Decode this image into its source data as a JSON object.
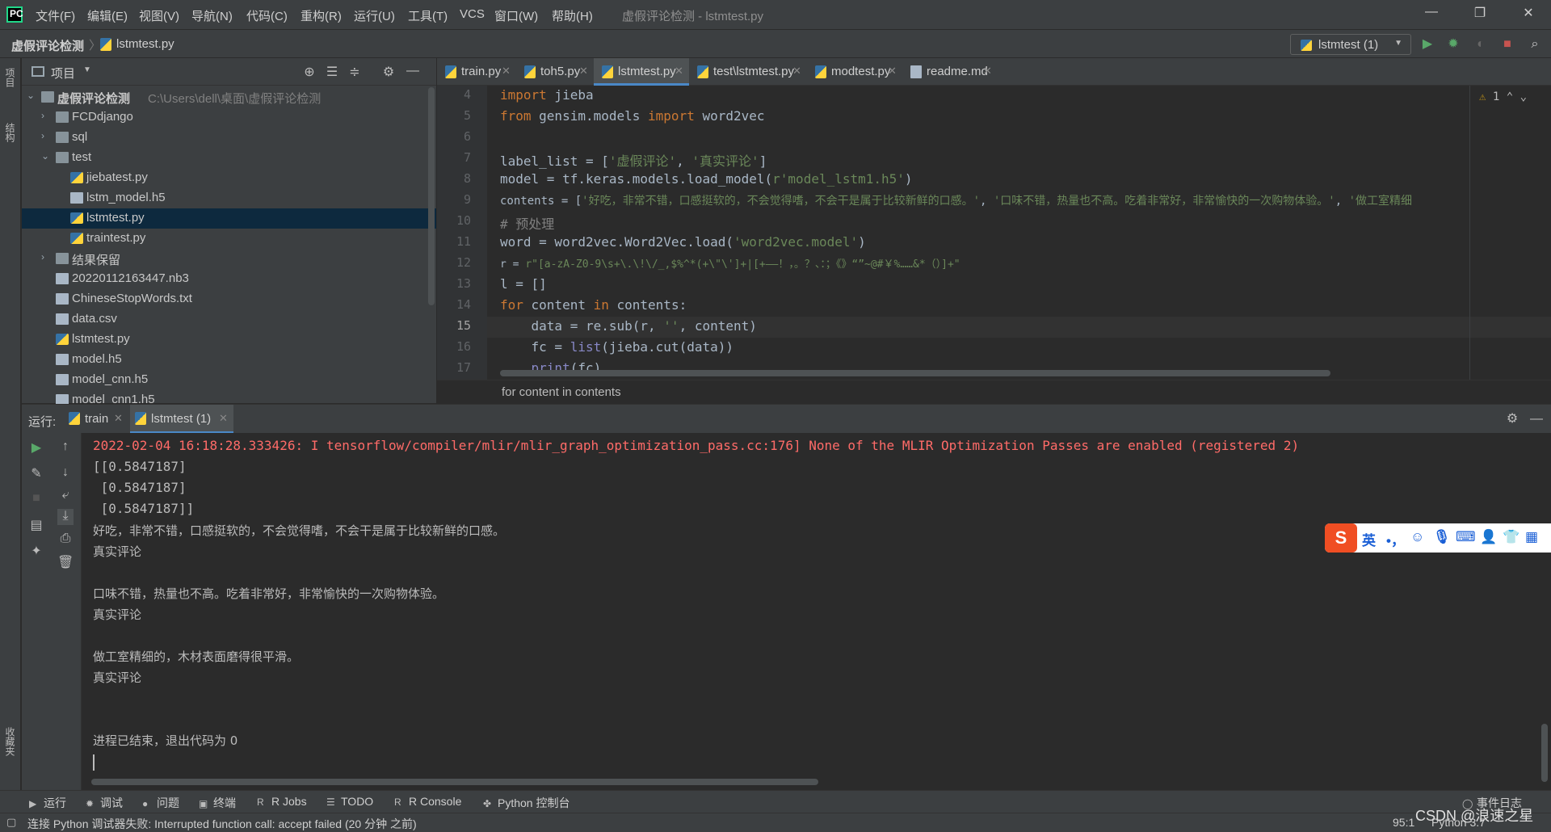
{
  "app": {
    "menu": [
      "文件(F)",
      "编辑(E)",
      "视图(V)",
      "导航(N)",
      "代码(C)",
      "重构(R)",
      "运行(U)",
      "工具(T)",
      "VCS",
      "窗口(W)",
      "帮助(H)"
    ],
    "window_title": "虚假评论检测 - lstmtest.py"
  },
  "navbar": {
    "project": "虚假评论检测",
    "file": "lstmtest.py",
    "run_config": "lstmtest (1)"
  },
  "left_strip": {
    "project_tab": "项目",
    "structure_tab": "结构",
    "favorites_tab": "收藏夹"
  },
  "project_panel": {
    "title": "项目",
    "tree": [
      {
        "label": "虚假评论检测",
        "path": "C:\\Users\\dell\\桌面\\虚假评论检测",
        "type": "folder",
        "expanded": true
      },
      {
        "label": "FCDdjango",
        "type": "folder",
        "expanded": false
      },
      {
        "label": "sql",
        "type": "folder",
        "expanded": false
      },
      {
        "label": "test",
        "type": "folder",
        "expanded": true
      },
      {
        "label": "jiebatest.py",
        "type": "py"
      },
      {
        "label": "lstm_model.h5",
        "type": "file"
      },
      {
        "label": "lstmtest.py",
        "type": "py",
        "selected": true
      },
      {
        "label": "traintest.py",
        "type": "py"
      },
      {
        "label": "结果保留",
        "type": "folder",
        "expanded": false
      },
      {
        "label": "20220112163447.nb3",
        "type": "file"
      },
      {
        "label": "ChineseStopWords.txt",
        "type": "file"
      },
      {
        "label": "data.csv",
        "type": "file"
      },
      {
        "label": "lstmtest.py",
        "type": "py"
      },
      {
        "label": "model.h5",
        "type": "file"
      },
      {
        "label": "model_cnn.h5",
        "type": "file"
      },
      {
        "label": "model_cnn1.h5",
        "type": "file"
      }
    ]
  },
  "editor": {
    "tabs": [
      "train.py",
      "toh5.py",
      "lstmtest.py",
      "test\\lstmtest.py",
      "modtest.py",
      "readme.md"
    ],
    "active_tab": "lstmtest.py",
    "warnings": "1",
    "line_numbers": [
      "4",
      "5",
      "6",
      "7",
      "8",
      "9",
      "10",
      "11",
      "12",
      "13",
      "14",
      "15",
      "16",
      "17"
    ],
    "current_line": "15",
    "code": {
      "l4_kw": "import",
      "l4_rest": " jieba",
      "l5_kw1": "from",
      "l5_mid": " gensim.models ",
      "l5_kw2": "import",
      "l5_rest": " word2vec",
      "l7_a": "label_list = [",
      "l7_s1": "'虚假评论'",
      "l7_b": ", ",
      "l7_s2": "'真实评论'",
      "l7_c": "]",
      "l8_a": "model = tf.keras.models.load_model(",
      "l8_s": "r'model_lstm1.h5'",
      "l8_b": ")",
      "l9_a": "contents = [",
      "l9_s1": "'好吃，非常不错，口感挺软的，不会觉得嗜，不会干是属于比较新鲜的口感。'",
      "l9_b": ", ",
      "l9_s2": "'口味不错，热量也不高。吃着非常好，非常愉快的一次购物体验。'",
      "l9_c": ", ",
      "l9_s3": "'做工室精细",
      "l10": "# 预处理",
      "l11_a": "word = word2vec.Word2Vec.load(",
      "l11_s": "'word2vec.model'",
      "l11_b": ")",
      "l12_a": "r = ",
      "l12_s": "r\"[a-zA-Z0-9\\s+\\.\\!\\/_,$%^*(+\\\"\\']+|[+——！，。？、：；《》“”~@#￥%……&*（）]+\"",
      "l13": "l = []",
      "l14_kw1": "for",
      "l14_a": " content ",
      "l14_kw2": "in",
      "l14_b": " contents:",
      "l15_a": "    data = re.sub(r, ",
      "l15_s": "''",
      "l15_b": ", content)",
      "l16_a": "    fc = ",
      "l16_bi": "list",
      "l16_b": "(jieba.cut(data))",
      "l17_bi": "    print",
      "l17_b": "(fc)"
    },
    "breadcrumb": "for content in contents"
  },
  "run_panel": {
    "label": "运行:",
    "tabs": [
      "train",
      "lstmtest (1)"
    ],
    "active_tab": "lstmtest (1)",
    "console": [
      {
        "text": "2022-02-04 16:18:28.333426: I tensorflow/compiler/mlir/mlir_graph_optimization_pass.cc:176] None of the MLIR Optimization Passes are enabled (registered 2)",
        "kind": "err"
      },
      {
        "text": "[[0.5847187]",
        "kind": "out"
      },
      {
        "text": " [0.5847187]",
        "kind": "out"
      },
      {
        "text": " [0.5847187]]",
        "kind": "out"
      },
      {
        "text": "好吃，非常不错，口感挺软的，不会觉得嗜，不会干是属于比较新鲜的口感。",
        "kind": "cn"
      },
      {
        "text": "真实评论",
        "kind": "cn"
      },
      {
        "text": "",
        "kind": "out"
      },
      {
        "text": "口味不错，热量也不高。吃着非常好，非常愉快的一次购物体验。",
        "kind": "cn"
      },
      {
        "text": "真实评论",
        "kind": "cn"
      },
      {
        "text": "",
        "kind": "out"
      },
      {
        "text": "做工室精细的，木材表面磨得很平滑。",
        "kind": "cn"
      },
      {
        "text": "真实评论",
        "kind": "cn"
      },
      {
        "text": "",
        "kind": "out"
      },
      {
        "text": "",
        "kind": "out"
      },
      {
        "text": "进程已结束，退出代码为 0",
        "kind": "cn"
      }
    ]
  },
  "ime": {
    "lang": "英",
    "punct": "•，"
  },
  "bottom_tools": [
    "运行",
    "调试",
    "问题",
    "终端",
    "R Jobs",
    "TODO",
    "R Console",
    "Python 控制台"
  ],
  "event_log": "事件日志",
  "status": {
    "message": "连接 Python 调试器失败: Interrupted function call: accept failed (20 分钟 之前)",
    "position": "95:1",
    "interpreter": "Python 3.7"
  },
  "watermark": "CSDN @浪速之星",
  "colors": {
    "accent": "#4a88c7",
    "keyword": "#cc7832",
    "string": "#6a8759",
    "error": "#ff6b68",
    "selection": "#0d293e"
  }
}
